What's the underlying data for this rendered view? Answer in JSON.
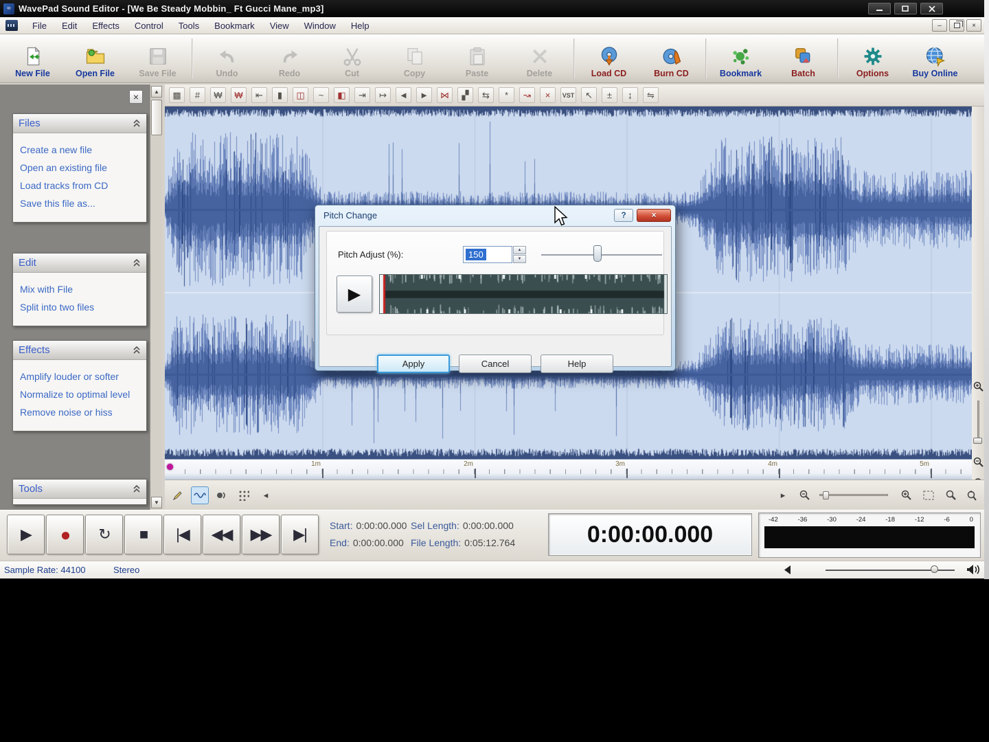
{
  "window": {
    "title": "WavePad Sound Editor - [We Be Steady Mobbin_ Ft Gucci Mane_mp3]"
  },
  "menu": {
    "items": [
      "File",
      "Edit",
      "Effects",
      "Control",
      "Tools",
      "Bookmark",
      "View",
      "Window",
      "Help"
    ]
  },
  "toolbar": {
    "buttons": [
      {
        "label": "New File",
        "enabled": true
      },
      {
        "label": "Open File",
        "enabled": true
      },
      {
        "label": "Save File",
        "enabled": false
      },
      {
        "label": "Undo",
        "enabled": false
      },
      {
        "label": "Redo",
        "enabled": false
      },
      {
        "label": "Cut",
        "enabled": false
      },
      {
        "label": "Copy",
        "enabled": false
      },
      {
        "label": "Paste",
        "enabled": false
      },
      {
        "label": "Delete",
        "enabled": false
      },
      {
        "label": "Load CD",
        "enabled": true
      },
      {
        "label": "Burn CD",
        "enabled": true
      },
      {
        "label": "Bookmark",
        "enabled": true
      },
      {
        "label": "Batch",
        "enabled": true
      },
      {
        "label": "Options",
        "enabled": true
      },
      {
        "label": "Buy Online",
        "enabled": true
      }
    ]
  },
  "edit_toolbar": {
    "icons": [
      "▩",
      "#",
      "₩",
      "₩",
      "⇤",
      "▮",
      "◫",
      "~",
      "◧",
      "⇥",
      "↦",
      "◄",
      "►",
      "⋈",
      "▞",
      "⇆",
      "*",
      "↝",
      "×",
      "VST",
      "↖",
      "±",
      "↨",
      "⇋"
    ]
  },
  "sidebar": {
    "panels": [
      {
        "title": "Files",
        "items": [
          "Create a new file",
          "Open an existing file",
          "Load tracks from CD",
          "Save this file as..."
        ]
      },
      {
        "title": "Edit",
        "items": [
          "Mix with File",
          "Split into two files"
        ]
      },
      {
        "title": "Effects",
        "items": [
          "Amplify louder or softer",
          "Normalize to optimal level",
          "Remove noise or hiss"
        ]
      },
      {
        "title": "Tools",
        "items": []
      }
    ]
  },
  "timeline": {
    "labels": [
      "1m",
      "2m",
      "3m",
      "4m",
      "5m"
    ]
  },
  "dialog": {
    "title": "Pitch Change",
    "field_label": "Pitch Adjust (%):",
    "value": "150",
    "apply_label": "Apply",
    "cancel_label": "Cancel",
    "help_label": "Help"
  },
  "transport": {
    "play": "▶",
    "record": "●",
    "loop": "↻",
    "stop": "■",
    "to_start": "|◀",
    "rewind": "◀◀",
    "fast_forward": "▶▶",
    "to_end": "▶|"
  },
  "times": {
    "start_label": "Start:",
    "start_value": "0:00:00.000",
    "sel_label": "Sel Length:",
    "sel_value": "0:00:00.000",
    "end_label": "End:",
    "end_value": "0:00:00.000",
    "file_label": "File Length:",
    "file_value": "0:05:12.764",
    "display": "0:00:00.000"
  },
  "meter": {
    "labels": [
      "-42",
      "-36",
      "-30",
      "-24",
      "-18",
      "-12",
      "-6",
      "0"
    ]
  },
  "status": {
    "sample_rate": "Sample Rate: 44100",
    "channels": "Stereo"
  },
  "glyphs": {
    "close_small": "×",
    "mdi_minimize": "–",
    "mdi_close": "×",
    "spin_up": "▲",
    "spin_down": "▼",
    "back_small": "◂",
    "fwd_small": "▸",
    "help_q": "?",
    "dialog_close": "×",
    "scroll_up": "▲",
    "scroll_down": "▼"
  },
  "colors": {
    "wave_fill": "#6e88c0",
    "wave_dark": "#46639f",
    "wave_bg": "#ccdaef",
    "record_red": "#b22222",
    "link_blue": "#3b68c5",
    "label_blue": "#16389e",
    "label_red": "#8b1e1e",
    "selection_blue": "#2f6fd0",
    "dialog_close_red": "#c0392b"
  }
}
